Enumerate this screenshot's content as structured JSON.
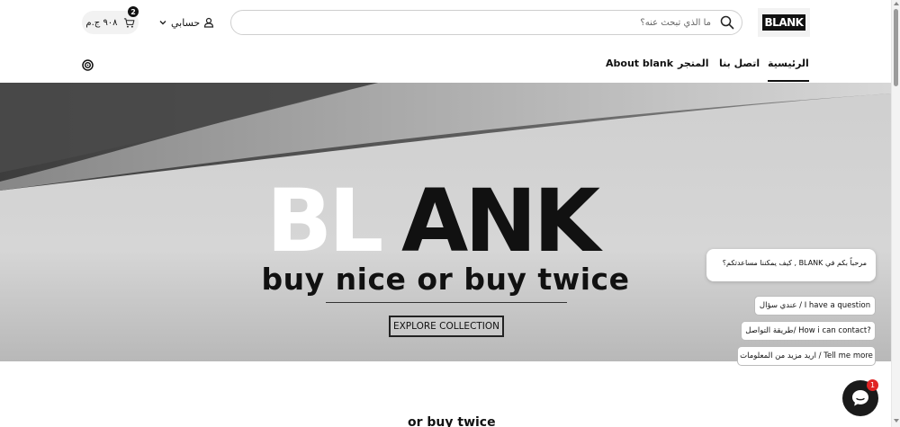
{
  "header": {
    "logo_text": "BLANK",
    "search": {
      "placeholder": "ما الذي تبحث عنه؟",
      "value": ""
    },
    "account_label": "حسابي",
    "cart": {
      "total": "٩٠٨ ج.م",
      "count": "2"
    }
  },
  "nav": {
    "items": [
      {
        "label": "الرئيسية",
        "active": true
      },
      {
        "label": "اتصل بنا"
      },
      {
        "label": "المتجر"
      },
      {
        "label": "About blank"
      }
    ],
    "social_icon": "target-icon"
  },
  "hero": {
    "brand_left": "BL",
    "brand_right": "ANK",
    "tagline": "buy nice or buy twice",
    "cta_label": "EXPLORE COLLECTION"
  },
  "below": {
    "partial_heading": "or buy twice"
  },
  "chat": {
    "greeting": "مرحباً بكم في BLANK , كيف يمكننا مساعدتكم؟",
    "options": [
      "عندي سؤال / I have a question",
      "طريقة التواصل/ How i can contact?",
      "اريد مزيد من المعلومات / Tell me more"
    ],
    "notification_count": "1"
  },
  "colors": {
    "accent": "#111111",
    "notify": "#e02424"
  }
}
